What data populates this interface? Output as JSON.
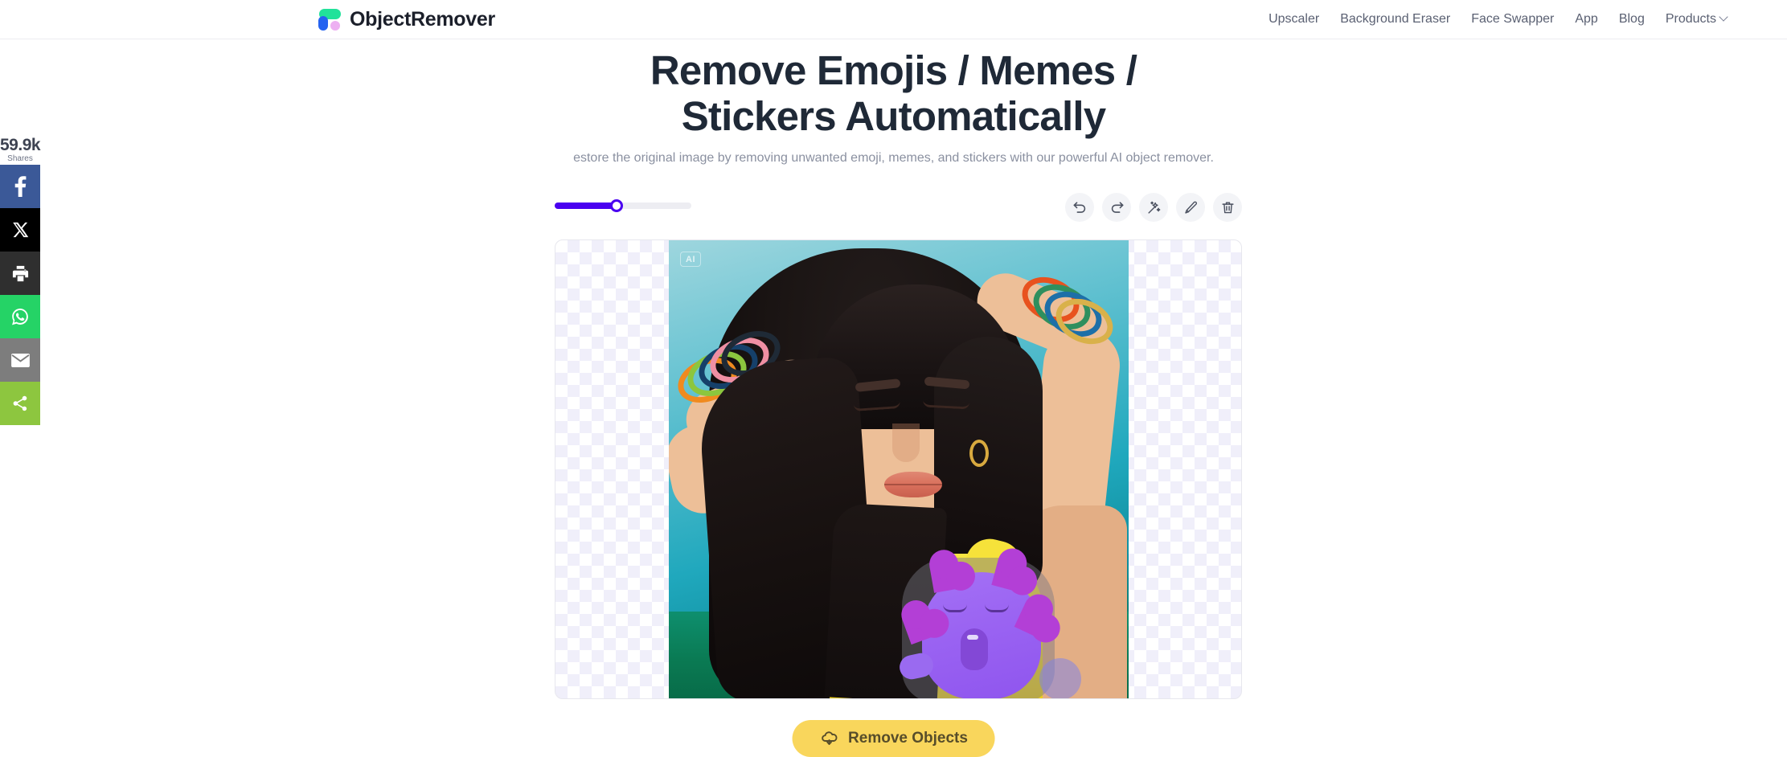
{
  "header": {
    "brand_name": "ObjectRemover",
    "logo_colors": {
      "green": "#21e29a",
      "blue": "#2563f0",
      "pink": "#edb0f2"
    },
    "nav": [
      {
        "label": "Upscaler",
        "has_chevron": false
      },
      {
        "label": "Background Eraser",
        "has_chevron": false
      },
      {
        "label": "Face Swapper",
        "has_chevron": false
      },
      {
        "label": "App",
        "has_chevron": false
      },
      {
        "label": "Blog",
        "has_chevron": false
      },
      {
        "label": "Products",
        "has_chevron": true
      }
    ]
  },
  "hero": {
    "title_line1": "Remove Emojis / Memes /",
    "title_line2": "Stickers Automatically",
    "subtitle": "estore the original image by removing unwanted emoji, memes, and stickers with our powerful AI object remover."
  },
  "social": {
    "count": "59.9k",
    "count_label": "Shares",
    "buttons": [
      {
        "name": "facebook",
        "color": "#3b5998"
      },
      {
        "name": "twitter-x",
        "color": "#000000"
      },
      {
        "name": "print",
        "color": "#2f2f2f"
      },
      {
        "name": "whatsapp",
        "color": "#25d366"
      },
      {
        "name": "email",
        "color": "#7d7d7d"
      },
      {
        "name": "share",
        "color": "#8dc63f"
      }
    ]
  },
  "editor": {
    "brush_slider": {
      "value_percent": 45,
      "fill_color": "#4a00f0",
      "track_color": "#ededf2"
    },
    "tools": [
      {
        "name": "undo",
        "title": "Undo"
      },
      {
        "name": "redo",
        "title": "Redo"
      },
      {
        "name": "magic-wand",
        "title": "Auto select"
      },
      {
        "name": "brush",
        "title": "Brush"
      },
      {
        "name": "trash",
        "title": "Clear"
      }
    ],
    "canvas": {
      "ai_badge": "AI",
      "brush_cursor_visible": true,
      "selection_mask_visible": true
    }
  },
  "cta": {
    "label": "Remove Objects",
    "background": "#f9d65c",
    "text_color": "#574d2a"
  }
}
